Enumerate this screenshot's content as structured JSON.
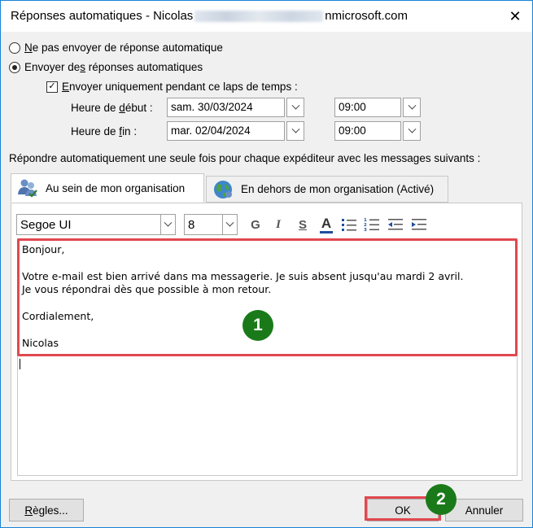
{
  "window": {
    "title_prefix": "Réponses automatiques - Nicolas",
    "title_suffix": "nmicrosoft.com",
    "close_glyph": "✕"
  },
  "options": {
    "no_reply": {
      "pre": "",
      "accel": "N",
      "post": "e pas envoyer de réponse automatique",
      "selected": false
    },
    "send_reply": {
      "pre": "Envoyer de",
      "accel": "s",
      "post": " réponses automatiques",
      "selected": true
    },
    "only_during": {
      "pre": "",
      "accel": "E",
      "post": "nvoyer uniquement pendant ce laps de temps :",
      "checked": true,
      "check_glyph": "✓"
    }
  },
  "start": {
    "label_pre": "Heure de ",
    "label_accel": "d",
    "label_post": "ébut :",
    "date": "sam. 30/03/2024",
    "time": "09:00"
  },
  "end": {
    "label_pre": "Heure de ",
    "label_accel": "f",
    "label_post": "in :",
    "date": "mar. 02/04/2024",
    "time": "09:00"
  },
  "instruction": "Répondre automatiquement une seule fois pour chaque expéditeur avec les messages suivants :",
  "tabs": [
    {
      "label": "Au sein de mon organisation",
      "icon": "people-icon",
      "active": true
    },
    {
      "label": "En dehors de mon organisation (Activé)",
      "icon": "globe-icon",
      "active": false
    }
  ],
  "format": {
    "font": "Segoe UI",
    "size": "8",
    "bold": "G",
    "italic": "I",
    "underline": "S",
    "color_letter": "A",
    "color_accent": "#1f4e9c"
  },
  "message": {
    "greeting": "Bonjour,",
    "line1": "Votre e-mail est bien arrivé dans ma messagerie. Je suis absent jusqu'au mardi 2 avril.",
    "line2": "Je vous répondrai dès que possible à mon retour.",
    "closing": "Cordialement,",
    "signature": "Nicolas"
  },
  "badges": {
    "one": "1",
    "two": "2"
  },
  "buttons": {
    "rules_accel": "R",
    "rules_post": "ègles...",
    "ok": "OK",
    "cancel": "Annuler"
  },
  "colors": {
    "highlight": "#e0484f",
    "badge": "#1a7a1a"
  }
}
